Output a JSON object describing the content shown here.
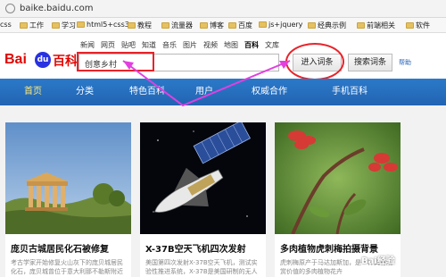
{
  "browser": {
    "url": "baike.baidu.com",
    "bookmarks": [
      {
        "label": "css",
        "folder": false
      },
      {
        "label": "工作",
        "folder": true
      },
      {
        "label": "学习",
        "folder": true
      },
      {
        "label": "html5+css3",
        "folder": true
      },
      {
        "label": "教程",
        "folder": true
      },
      {
        "label": "流量器",
        "folder": true
      },
      {
        "label": "博客",
        "folder": true
      },
      {
        "label": "百度",
        "folder": true
      },
      {
        "label": "js+jquery",
        "folder": true
      },
      {
        "label": "经典示例",
        "folder": true
      },
      {
        "label": "前端相关",
        "folder": true
      },
      {
        "label": "软件",
        "folder": true
      }
    ]
  },
  "top_nav": [
    "新闻",
    "网页",
    "贴吧",
    "知道",
    "音乐",
    "图片",
    "视频",
    "地图",
    "百科",
    "文库"
  ],
  "top_nav_active": "百科",
  "logo": {
    "bai": "Bai",
    "du": "du",
    "ke": "百科"
  },
  "search": {
    "value": "创意乡村"
  },
  "buttons": {
    "enter": "进入词条",
    "search": "搜索词条",
    "help": "帮助"
  },
  "menu": [
    "首页",
    "分类",
    "特色百科",
    "用户",
    "权威合作",
    "手机百科"
  ],
  "menu_active": "首页",
  "cards": [
    {
      "title": "庞贝古城居民化石被修复",
      "desc": "考古学家开始修复火山灰下的庞贝城居民化石，庞贝城曾位于意大利那不勒斯附近"
    },
    {
      "title": "X-37B空天飞机四次发射",
      "desc": "美国第四次发射X-37B空天飞机，测试实验性推进系统，X-37B是美国研制的无人驾驶"
    },
    {
      "title": "多肉植物虎刺梅拍摄背景",
      "desc": "虎刺梅原产于马达加斯加，是一种具有观赏价值的多肉植物花卉"
    }
  ],
  "watermark": "Bai经验",
  "colors": {
    "menu_bg": "#2164b3",
    "annotation": "#e8232a",
    "arrow": "#e23fe0",
    "logo_red": "#e10602",
    "logo_blue": "#2932e1"
  }
}
